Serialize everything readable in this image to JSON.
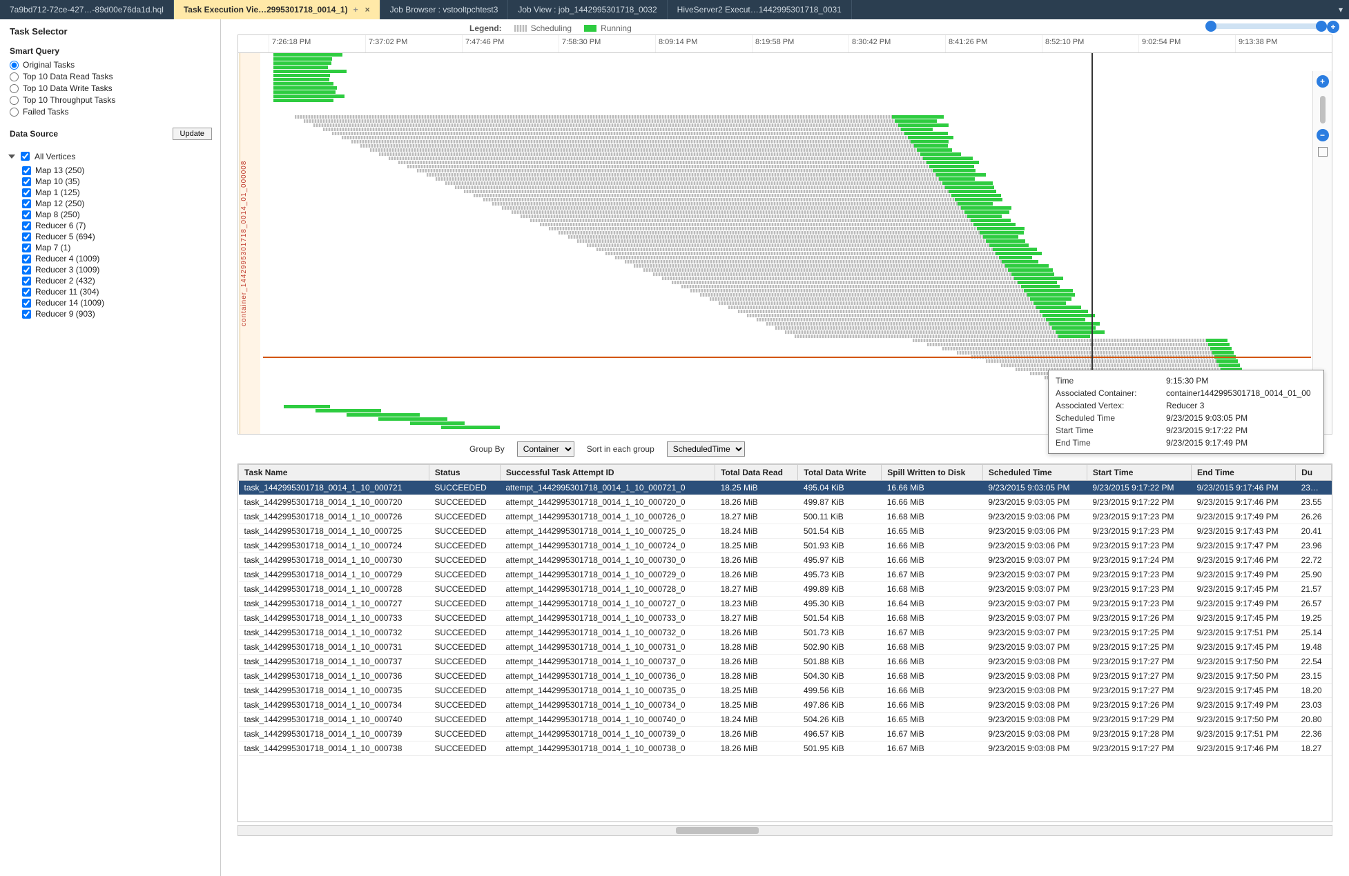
{
  "tabs": [
    {
      "label": "7a9bd712-72ce-427…-89d00e76da1d.hql"
    },
    {
      "label": "Task Execution Vie…2995301718_0014_1)",
      "active": true,
      "closable": true
    },
    {
      "label": "Job Browser : vstooltpchtest3"
    },
    {
      "label": "Job View : job_1442995301718_0032"
    },
    {
      "label": "HiveServer2 Execut…1442995301718_0031"
    }
  ],
  "sidebar": {
    "title": "Task Selector",
    "smart_query_title": "Smart Query",
    "smart_query_options": [
      {
        "label": "Original Tasks",
        "selected": true
      },
      {
        "label": "Top 10 Data Read Tasks"
      },
      {
        "label": "Top 10 Data Write Tasks"
      },
      {
        "label": "Top 10 Throughput Tasks"
      },
      {
        "label": "Failed Tasks"
      }
    ],
    "data_source_label": "Data Source",
    "update_button": "Update",
    "tree_root": "All Vertices",
    "tree_items": [
      "Map 13 (250)",
      "Map 10 (35)",
      "Map 1 (125)",
      "Map 12 (250)",
      "Map 8 (250)",
      "Reducer 6 (7)",
      "Reducer 5 (694)",
      "Map 7 (1)",
      "Reducer 4 (1009)",
      "Reducer 3 (1009)",
      "Reducer 2 (432)",
      "Reducer 11 (304)",
      "Reducer 14 (1009)",
      "Reducer 9 (903)"
    ]
  },
  "legend": {
    "title": "Legend:",
    "scheduling": "Scheduling",
    "running": "Running"
  },
  "time_ticks": [
    "7:26:18 PM",
    "7:37:02 PM",
    "7:47:46 PM",
    "7:58:30 PM",
    "8:09:14 PM",
    "8:19:58 PM",
    "8:30:42 PM",
    "8:41:26 PM",
    "8:52:10 PM",
    "9:02:54 PM",
    "9:13:38 PM"
  ],
  "container_label": "container_1442995301718_0014_01_000008",
  "tooltip": {
    "rows": [
      [
        "Time",
        "9:15:30 PM"
      ],
      [
        "Associated Container:",
        "container1442995301718_0014_01_00"
      ],
      [
        "Associated Vertex:",
        "Reducer 3"
      ],
      [
        "Scheduled Time",
        "9/23/2015 9:03:05 PM"
      ],
      [
        "Start Time",
        "9/23/2015 9:17:22 PM"
      ],
      [
        "End Time",
        "9/23/2015 9:17:49 PM"
      ]
    ]
  },
  "groupby": {
    "label": "Group By",
    "selected": "Container",
    "options": [
      "Container"
    ],
    "sort_label": "Sort in each group",
    "sort_selected": "ScheduledTime",
    "sort_options": [
      "ScheduledTime"
    ]
  },
  "table": {
    "headers": [
      "Task Name",
      "Status",
      "Successful Task Attempt ID",
      "Total Data Read",
      "Total Data Write",
      "Spill Written to Disk",
      "Scheduled Time",
      "Start Time",
      "End Time",
      "Du"
    ],
    "rows": [
      [
        "task_1442995301718_0014_1_10_000721",
        "SUCCEEDED",
        "attempt_1442995301718_0014_1_10_000721_0",
        "18.25 MiB",
        "495.04 KiB",
        "16.66 MiB",
        "9/23/2015 9:03:05 PM",
        "9/23/2015 9:17:22 PM",
        "9/23/2015 9:17:46 PM",
        "23…"
      ],
      [
        "task_1442995301718_0014_1_10_000720",
        "SUCCEEDED",
        "attempt_1442995301718_0014_1_10_000720_0",
        "18.26 MiB",
        "499.87 KiB",
        "16.66 MiB",
        "9/23/2015 9:03:05 PM",
        "9/23/2015 9:17:22 PM",
        "9/23/2015 9:17:46 PM",
        "23.55"
      ],
      [
        "task_1442995301718_0014_1_10_000726",
        "SUCCEEDED",
        "attempt_1442995301718_0014_1_10_000726_0",
        "18.27 MiB",
        "500.11 KiB",
        "16.68 MiB",
        "9/23/2015 9:03:06 PM",
        "9/23/2015 9:17:23 PM",
        "9/23/2015 9:17:49 PM",
        "26.26"
      ],
      [
        "task_1442995301718_0014_1_10_000725",
        "SUCCEEDED",
        "attempt_1442995301718_0014_1_10_000725_0",
        "18.24 MiB",
        "501.54 KiB",
        "16.65 MiB",
        "9/23/2015 9:03:06 PM",
        "9/23/2015 9:17:23 PM",
        "9/23/2015 9:17:43 PM",
        "20.41"
      ],
      [
        "task_1442995301718_0014_1_10_000724",
        "SUCCEEDED",
        "attempt_1442995301718_0014_1_10_000724_0",
        "18.25 MiB",
        "501.93 KiB",
        "16.66 MiB",
        "9/23/2015 9:03:06 PM",
        "9/23/2015 9:17:23 PM",
        "9/23/2015 9:17:47 PM",
        "23.96"
      ],
      [
        "task_1442995301718_0014_1_10_000730",
        "SUCCEEDED",
        "attempt_1442995301718_0014_1_10_000730_0",
        "18.26 MiB",
        "495.97 KiB",
        "16.66 MiB",
        "9/23/2015 9:03:07 PM",
        "9/23/2015 9:17:24 PM",
        "9/23/2015 9:17:46 PM",
        "22.72"
      ],
      [
        "task_1442995301718_0014_1_10_000729",
        "SUCCEEDED",
        "attempt_1442995301718_0014_1_10_000729_0",
        "18.26 MiB",
        "495.73 KiB",
        "16.67 MiB",
        "9/23/2015 9:03:07 PM",
        "9/23/2015 9:17:23 PM",
        "9/23/2015 9:17:49 PM",
        "25.90"
      ],
      [
        "task_1442995301718_0014_1_10_000728",
        "SUCCEEDED",
        "attempt_1442995301718_0014_1_10_000728_0",
        "18.27 MiB",
        "499.89 KiB",
        "16.68 MiB",
        "9/23/2015 9:03:07 PM",
        "9/23/2015 9:17:23 PM",
        "9/23/2015 9:17:45 PM",
        "21.57"
      ],
      [
        "task_1442995301718_0014_1_10_000727",
        "SUCCEEDED",
        "attempt_1442995301718_0014_1_10_000727_0",
        "18.23 MiB",
        "495.30 KiB",
        "16.64 MiB",
        "9/23/2015 9:03:07 PM",
        "9/23/2015 9:17:23 PM",
        "9/23/2015 9:17:49 PM",
        "26.57"
      ],
      [
        "task_1442995301718_0014_1_10_000733",
        "SUCCEEDED",
        "attempt_1442995301718_0014_1_10_000733_0",
        "18.27 MiB",
        "501.54 KiB",
        "16.68 MiB",
        "9/23/2015 9:03:07 PM",
        "9/23/2015 9:17:26 PM",
        "9/23/2015 9:17:45 PM",
        "19.25"
      ],
      [
        "task_1442995301718_0014_1_10_000732",
        "SUCCEEDED",
        "attempt_1442995301718_0014_1_10_000732_0",
        "18.26 MiB",
        "501.73 KiB",
        "16.67 MiB",
        "9/23/2015 9:03:07 PM",
        "9/23/2015 9:17:25 PM",
        "9/23/2015 9:17:51 PM",
        "25.14"
      ],
      [
        "task_1442995301718_0014_1_10_000731",
        "SUCCEEDED",
        "attempt_1442995301718_0014_1_10_000731_0",
        "18.28 MiB",
        "502.90 KiB",
        "16.68 MiB",
        "9/23/2015 9:03:07 PM",
        "9/23/2015 9:17:25 PM",
        "9/23/2015 9:17:45 PM",
        "19.48"
      ],
      [
        "task_1442995301718_0014_1_10_000737",
        "SUCCEEDED",
        "attempt_1442995301718_0014_1_10_000737_0",
        "18.26 MiB",
        "501.88 KiB",
        "16.66 MiB",
        "9/23/2015 9:03:08 PM",
        "9/23/2015 9:17:27 PM",
        "9/23/2015 9:17:50 PM",
        "22.54"
      ],
      [
        "task_1442995301718_0014_1_10_000736",
        "SUCCEEDED",
        "attempt_1442995301718_0014_1_10_000736_0",
        "18.28 MiB",
        "504.30 KiB",
        "16.68 MiB",
        "9/23/2015 9:03:08 PM",
        "9/23/2015 9:17:27 PM",
        "9/23/2015 9:17:50 PM",
        "23.15"
      ],
      [
        "task_1442995301718_0014_1_10_000735",
        "SUCCEEDED",
        "attempt_1442995301718_0014_1_10_000735_0",
        "18.25 MiB",
        "499.56 KiB",
        "16.66 MiB",
        "9/23/2015 9:03:08 PM",
        "9/23/2015 9:17:27 PM",
        "9/23/2015 9:17:45 PM",
        "18.20"
      ],
      [
        "task_1442995301718_0014_1_10_000734",
        "SUCCEEDED",
        "attempt_1442995301718_0014_1_10_000734_0",
        "18.25 MiB",
        "497.86 KiB",
        "16.66 MiB",
        "9/23/2015 9:03:08 PM",
        "9/23/2015 9:17:26 PM",
        "9/23/2015 9:17:49 PM",
        "23.03"
      ],
      [
        "task_1442995301718_0014_1_10_000740",
        "SUCCEEDED",
        "attempt_1442995301718_0014_1_10_000740_0",
        "18.24 MiB",
        "504.26 KiB",
        "16.65 MiB",
        "9/23/2015 9:03:08 PM",
        "9/23/2015 9:17:29 PM",
        "9/23/2015 9:17:50 PM",
        "20.80"
      ],
      [
        "task_1442995301718_0014_1_10_000739",
        "SUCCEEDED",
        "attempt_1442995301718_0014_1_10_000739_0",
        "18.26 MiB",
        "496.57 KiB",
        "16.67 MiB",
        "9/23/2015 9:03:08 PM",
        "9/23/2015 9:17:28 PM",
        "9/23/2015 9:17:51 PM",
        "22.36"
      ],
      [
        "task_1442995301718_0014_1_10_000738",
        "SUCCEEDED",
        "attempt_1442995301718_0014_1_10_000738_0",
        "18.26 MiB",
        "501.95 KiB",
        "16.67 MiB",
        "9/23/2015 9:03:08 PM",
        "9/23/2015 9:17:27 PM",
        "9/23/2015 9:17:46 PM",
        "18.27"
      ]
    ],
    "selected_row": 0
  }
}
